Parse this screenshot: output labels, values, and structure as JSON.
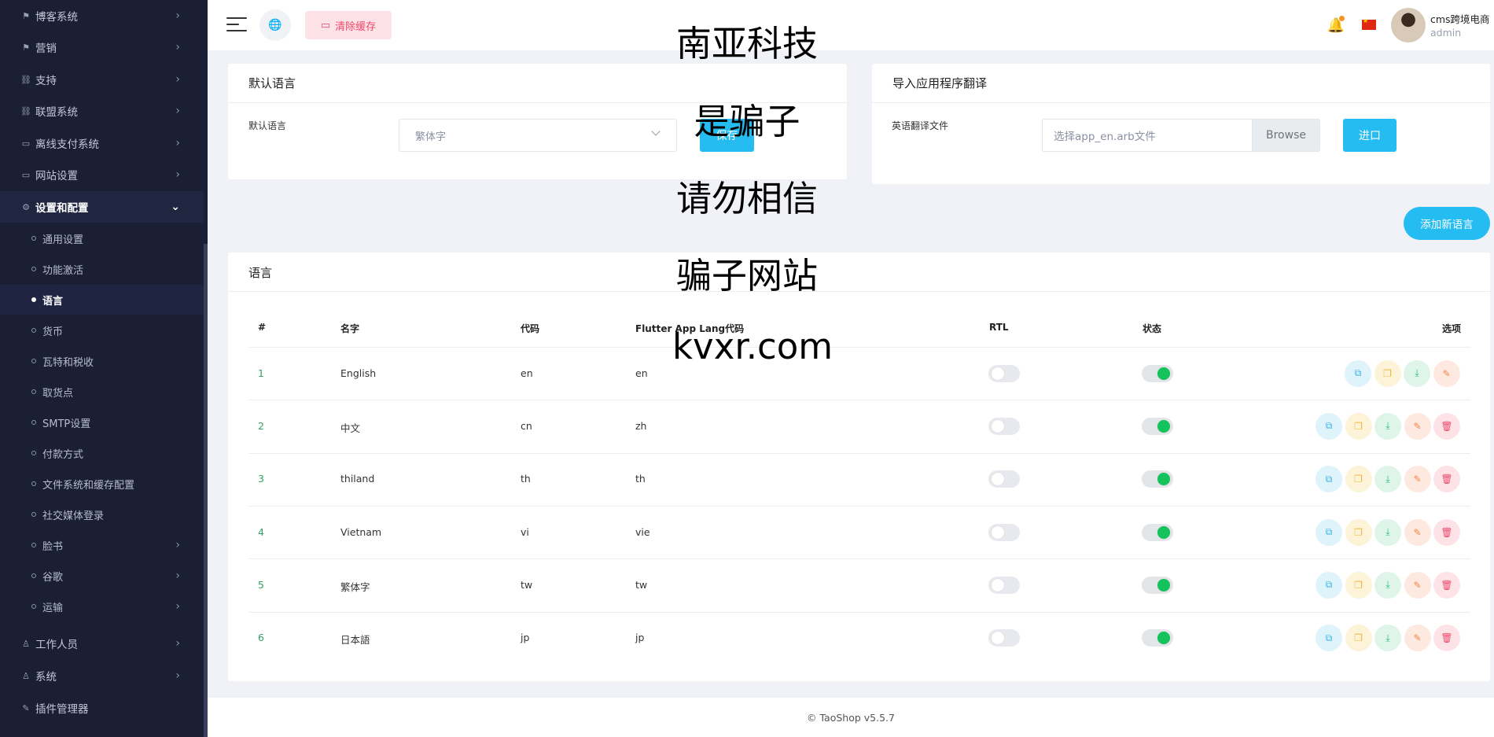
{
  "sidebar": {
    "items_top": [
      {
        "icon": "megaphone-icon",
        "glyph": "⚑",
        "label": "博客系统"
      },
      {
        "icon": "megaphone-icon",
        "glyph": "⚑",
        "label": "营销"
      },
      {
        "icon": "link-icon",
        "glyph": "⛓",
        "label": "支持"
      },
      {
        "icon": "link-icon",
        "glyph": "⛓",
        "label": "联盟系统"
      },
      {
        "icon": "money-icon",
        "glyph": "▭",
        "label": "离线支付系统"
      },
      {
        "icon": "monitor-icon",
        "glyph": "▭",
        "label": "网站设置"
      },
      {
        "icon": "gear-icon",
        "glyph": "⚙",
        "label": "设置和配置"
      }
    ],
    "sub_items": [
      {
        "label": "通用设置"
      },
      {
        "label": "功能激活"
      },
      {
        "label": "语言"
      },
      {
        "label": "货币"
      },
      {
        "label": "瓦特和税收"
      },
      {
        "label": "取货点"
      },
      {
        "label": "SMTP设置"
      },
      {
        "label": "付款方式"
      },
      {
        "label": "文件系统和缓存配置"
      },
      {
        "label": "社交媒体登录"
      },
      {
        "label": "脸书"
      },
      {
        "label": "谷歌"
      },
      {
        "label": "运输"
      }
    ],
    "items_bottom": [
      {
        "icon": "user-icon",
        "glyph": "♙",
        "label": "工作人员"
      },
      {
        "icon": "user-icon",
        "glyph": "♙",
        "label": "系统"
      },
      {
        "icon": "wrench-icon",
        "glyph": "✎",
        "label": "插件管理器"
      }
    ]
  },
  "header": {
    "clear_cache": "清除缓存",
    "user_name": "cms跨境电商",
    "user_role": "admin"
  },
  "default_lang_card": {
    "title": "默认语言",
    "field_label": "默认语言",
    "selected": "繁体字",
    "save": "保存"
  },
  "import_card": {
    "title": "导入应用程序翻译",
    "field_label": "英语翻译文件",
    "placeholder": "选择app_en.arb文件",
    "browse": "Browse",
    "import": "进口"
  },
  "add_language": "添加新语言",
  "language_card": {
    "title": "语言",
    "columns": [
      "#",
      "名字",
      "代码",
      "Flutter App Lang代码",
      "RTL",
      "状态",
      "选项"
    ],
    "rows": [
      {
        "num": "1",
        "name": "English",
        "code": "en",
        "flutter": "en",
        "rtl": false,
        "status": true,
        "deletable": false
      },
      {
        "num": "2",
        "name": "中文",
        "code": "cn",
        "flutter": "zh",
        "rtl": false,
        "status": true,
        "deletable": true
      },
      {
        "num": "3",
        "name": "thiland",
        "code": "th",
        "flutter": "th",
        "rtl": false,
        "status": true,
        "deletable": true
      },
      {
        "num": "4",
        "name": "Vietnam",
        "code": "vi",
        "flutter": "vie",
        "rtl": false,
        "status": true,
        "deletable": true
      },
      {
        "num": "5",
        "name": "繁体字",
        "code": "tw",
        "flutter": "tw",
        "rtl": false,
        "status": true,
        "deletable": true
      },
      {
        "num": "6",
        "name": "日本語",
        "code": "jp",
        "flutter": "jp",
        "rtl": false,
        "status": true,
        "deletable": true
      }
    ]
  },
  "overlay": [
    "南亚科技",
    "是骗子",
    "请勿相信",
    "骗子网站",
    "kvxr.com"
  ],
  "footer": "© TaoShop v5.5.7"
}
